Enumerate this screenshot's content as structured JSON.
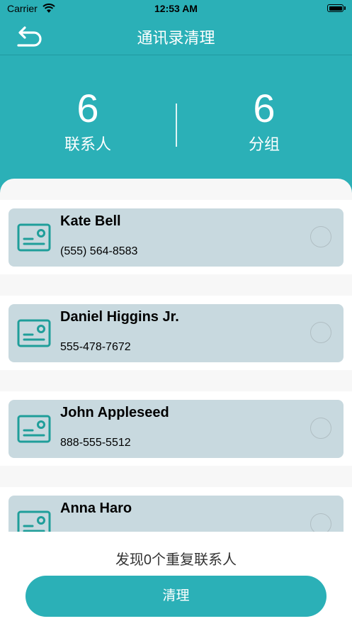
{
  "status_bar": {
    "carrier": "Carrier",
    "time": "12:53 AM"
  },
  "nav": {
    "title": "通讯录清理",
    "back_icon": "return-arrow-icon"
  },
  "stats": {
    "contacts": {
      "value": "6",
      "label": "联系人"
    },
    "groups": {
      "value": "6",
      "label": "分组"
    }
  },
  "contacts": [
    {
      "name": "Kate Bell",
      "phone": "(555) 564-8583",
      "selected": false
    },
    {
      "name": "Daniel Higgins Jr.",
      "phone": "555-478-7672",
      "selected": false
    },
    {
      "name": "John Appleseed",
      "phone": "888-555-5512",
      "selected": false
    },
    {
      "name": "Anna Haro",
      "phone": "",
      "selected": false
    }
  ],
  "footer": {
    "found_text": "发现0个重复联系人",
    "clean_button": "清理"
  },
  "colors": {
    "accent": "#2bb0b7",
    "card": "#c8d9df",
    "icon": "#1f9e9a"
  }
}
